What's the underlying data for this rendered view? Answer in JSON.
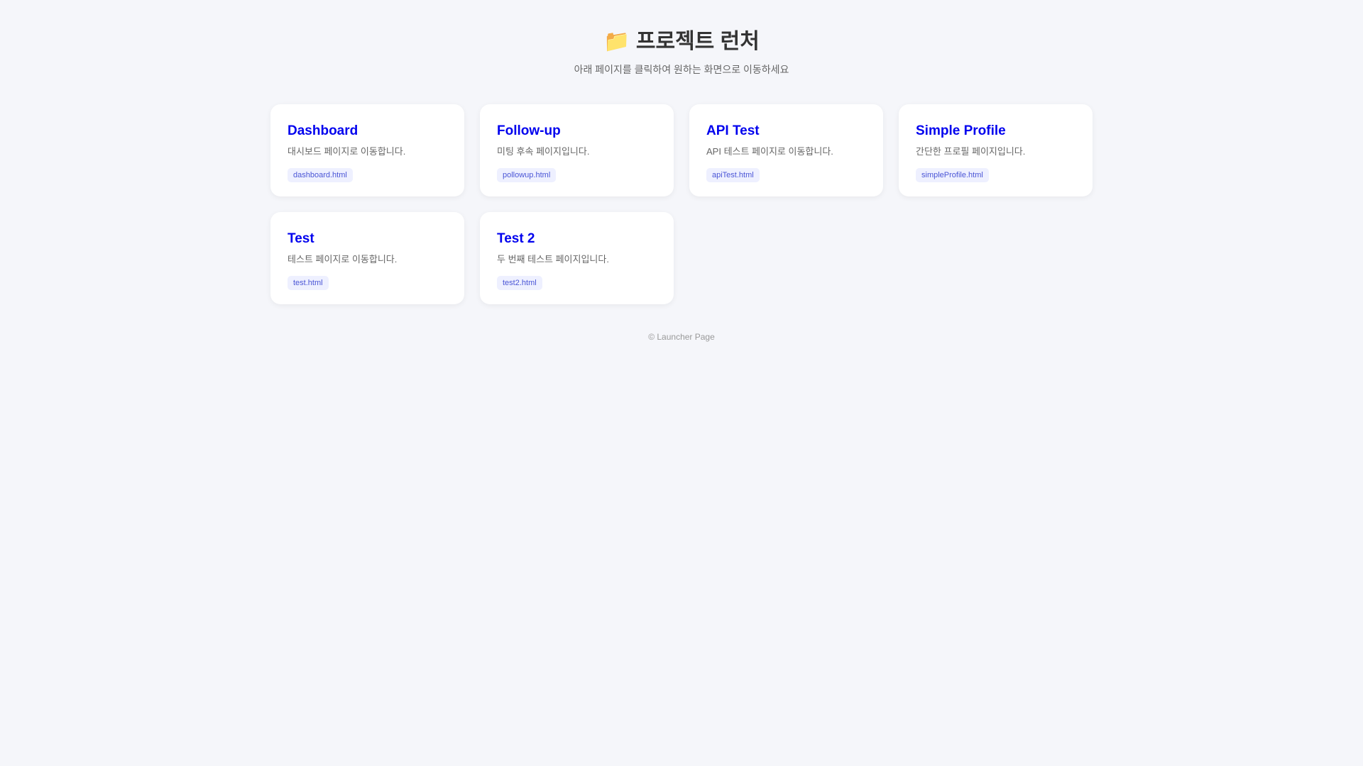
{
  "header": {
    "icon": "📁",
    "title": "프로젝트 런처",
    "subtitle": "아래 페이지를 클릭하여 원하는 화면으로 이동하세요"
  },
  "cards": [
    {
      "title": "Dashboard",
      "desc": "대시보드 페이지로 이동합니다.",
      "file": "dashboard.html"
    },
    {
      "title": "Follow-up",
      "desc": "미팅 후속 페이지입니다.",
      "file": "pollowup.html"
    },
    {
      "title": "API Test",
      "desc": "API 테스트 페이지로 이동합니다.",
      "file": "apiTest.html"
    },
    {
      "title": "Simple Profile",
      "desc": "간단한 프로필 페이지입니다.",
      "file": "simpleProfile.html"
    },
    {
      "title": "Test",
      "desc": "테스트 페이지로 이동합니다.",
      "file": "test.html"
    },
    {
      "title": "Test 2",
      "desc": "두 번째 테스트 페이지입니다.",
      "file": "test2.html"
    }
  ],
  "footer": "© Launcher Page"
}
